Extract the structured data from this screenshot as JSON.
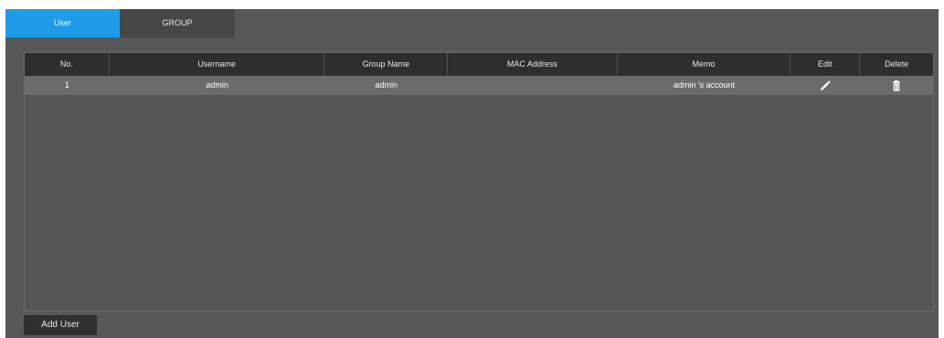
{
  "tabs": [
    {
      "label": "User",
      "active": true
    },
    {
      "label": "GROUP",
      "active": false
    }
  ],
  "table": {
    "columns": [
      "No.",
      "Username",
      "Group Name",
      "MAC Address",
      "Memo",
      "Edit",
      "Delete"
    ],
    "rows": [
      {
        "no": "1",
        "username": "admin",
        "group": "admin",
        "mac": "",
        "memo": "admin 's account",
        "edit_icon": "pencil-icon",
        "delete_icon": "trash-icon"
      }
    ]
  },
  "actions": {
    "add_user_label": "Add User"
  },
  "colors": {
    "active_tab": "#1e9be8",
    "inactive_tab": "#474747",
    "panel": "#585858",
    "header": "#2e2e2e",
    "row": "#6b6b6b"
  }
}
